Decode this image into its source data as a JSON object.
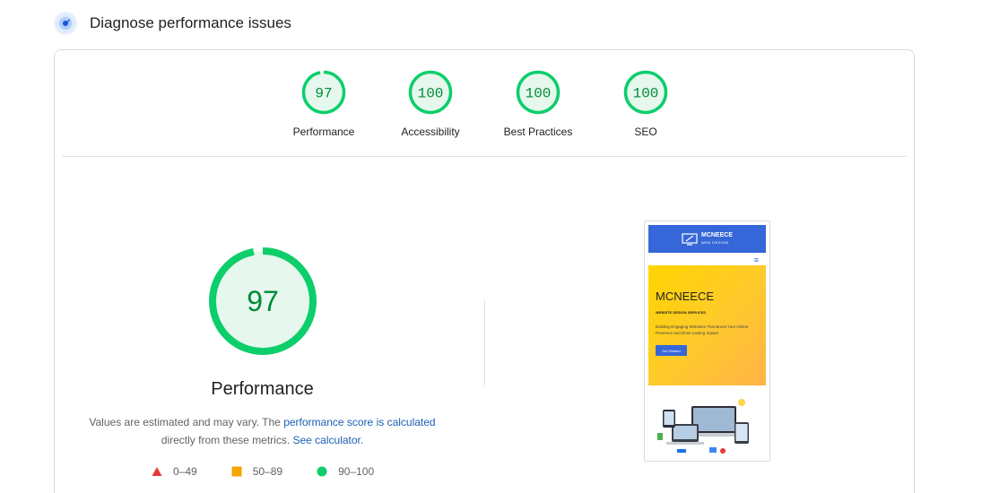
{
  "header": {
    "title": "Diagnose performance issues",
    "icon": "lighthouse-icon"
  },
  "categories": [
    {
      "label": "Performance",
      "score": "97",
      "value": 97
    },
    {
      "label": "Accessibility",
      "score": "100",
      "value": 100
    },
    {
      "label": "Best Practices",
      "score": "100",
      "value": 100
    },
    {
      "label": "SEO",
      "score": "100",
      "value": 100
    }
  ],
  "main": {
    "score": "97",
    "value": 97,
    "label": "Performance",
    "note_prefix": "Values are estimated and may vary. The",
    "note_link1": "performance score is calculated",
    "note_middle": "directly from these metrics.",
    "note_link2": "See calculator."
  },
  "legend": [
    {
      "range": "0–49",
      "shape": "triangle",
      "color": "#e53935"
    },
    {
      "range": "50–89",
      "shape": "square",
      "color": "#f4a300"
    },
    {
      "range": "90–100",
      "shape": "circle",
      "color": "#0cce6b"
    }
  ],
  "colors": {
    "good": "#0cce6b",
    "good_fill": "#e6f8ed",
    "good_text": "#008a37",
    "link": "#1a5fb4"
  },
  "screenshot": {
    "brand": "MCNEECE",
    "brand_sub": "WEB DESIGN",
    "heading": "MCNEECE",
    "subheading": "WEBSITE DESIGN SERVICES",
    "text": "Building Engaging Websites That Boost Your Online Presence and Drive Lasting Impact",
    "button": "Get Started"
  }
}
